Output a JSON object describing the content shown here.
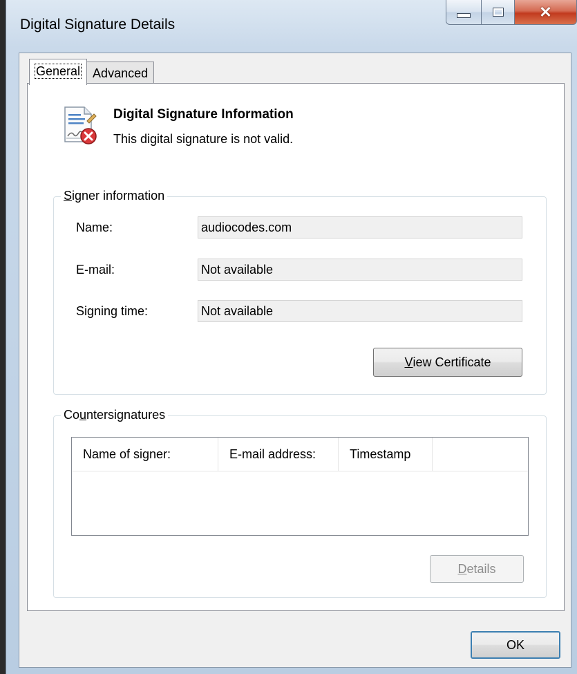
{
  "window": {
    "title": "Digital Signature Details"
  },
  "tabs": [
    {
      "label": "General",
      "active": true
    },
    {
      "label": "Advanced",
      "active": false
    }
  ],
  "header": {
    "title": "Digital Signature Information",
    "status": "This digital signature is not valid.",
    "icon": "invalid-signature-icon"
  },
  "signer": {
    "group_label_mnemonic": "S",
    "group_label_rest": "igner information",
    "fields": [
      {
        "label": "Name:",
        "value": "audiocodes.com"
      },
      {
        "label": "E-mail:",
        "value": "Not available"
      },
      {
        "label": "Signing time:",
        "value": "Not available"
      }
    ],
    "view_cert_mnemonic": "V",
    "view_cert_rest": "iew Certificate"
  },
  "countersignatures": {
    "group_label_pre": "Co",
    "group_label_mnemonic": "u",
    "group_label_rest": "ntersignatures",
    "columns": [
      "Name of signer:",
      "E-mail address:",
      "Timestamp"
    ],
    "rows": [],
    "details_mnemonic": "D",
    "details_rest": "etails"
  },
  "footer": {
    "ok_label": "OK"
  },
  "colors": {
    "close_button": "#c23b1f",
    "field_background": "#f0f0f0",
    "disabled_text": "#8d8d8d"
  }
}
